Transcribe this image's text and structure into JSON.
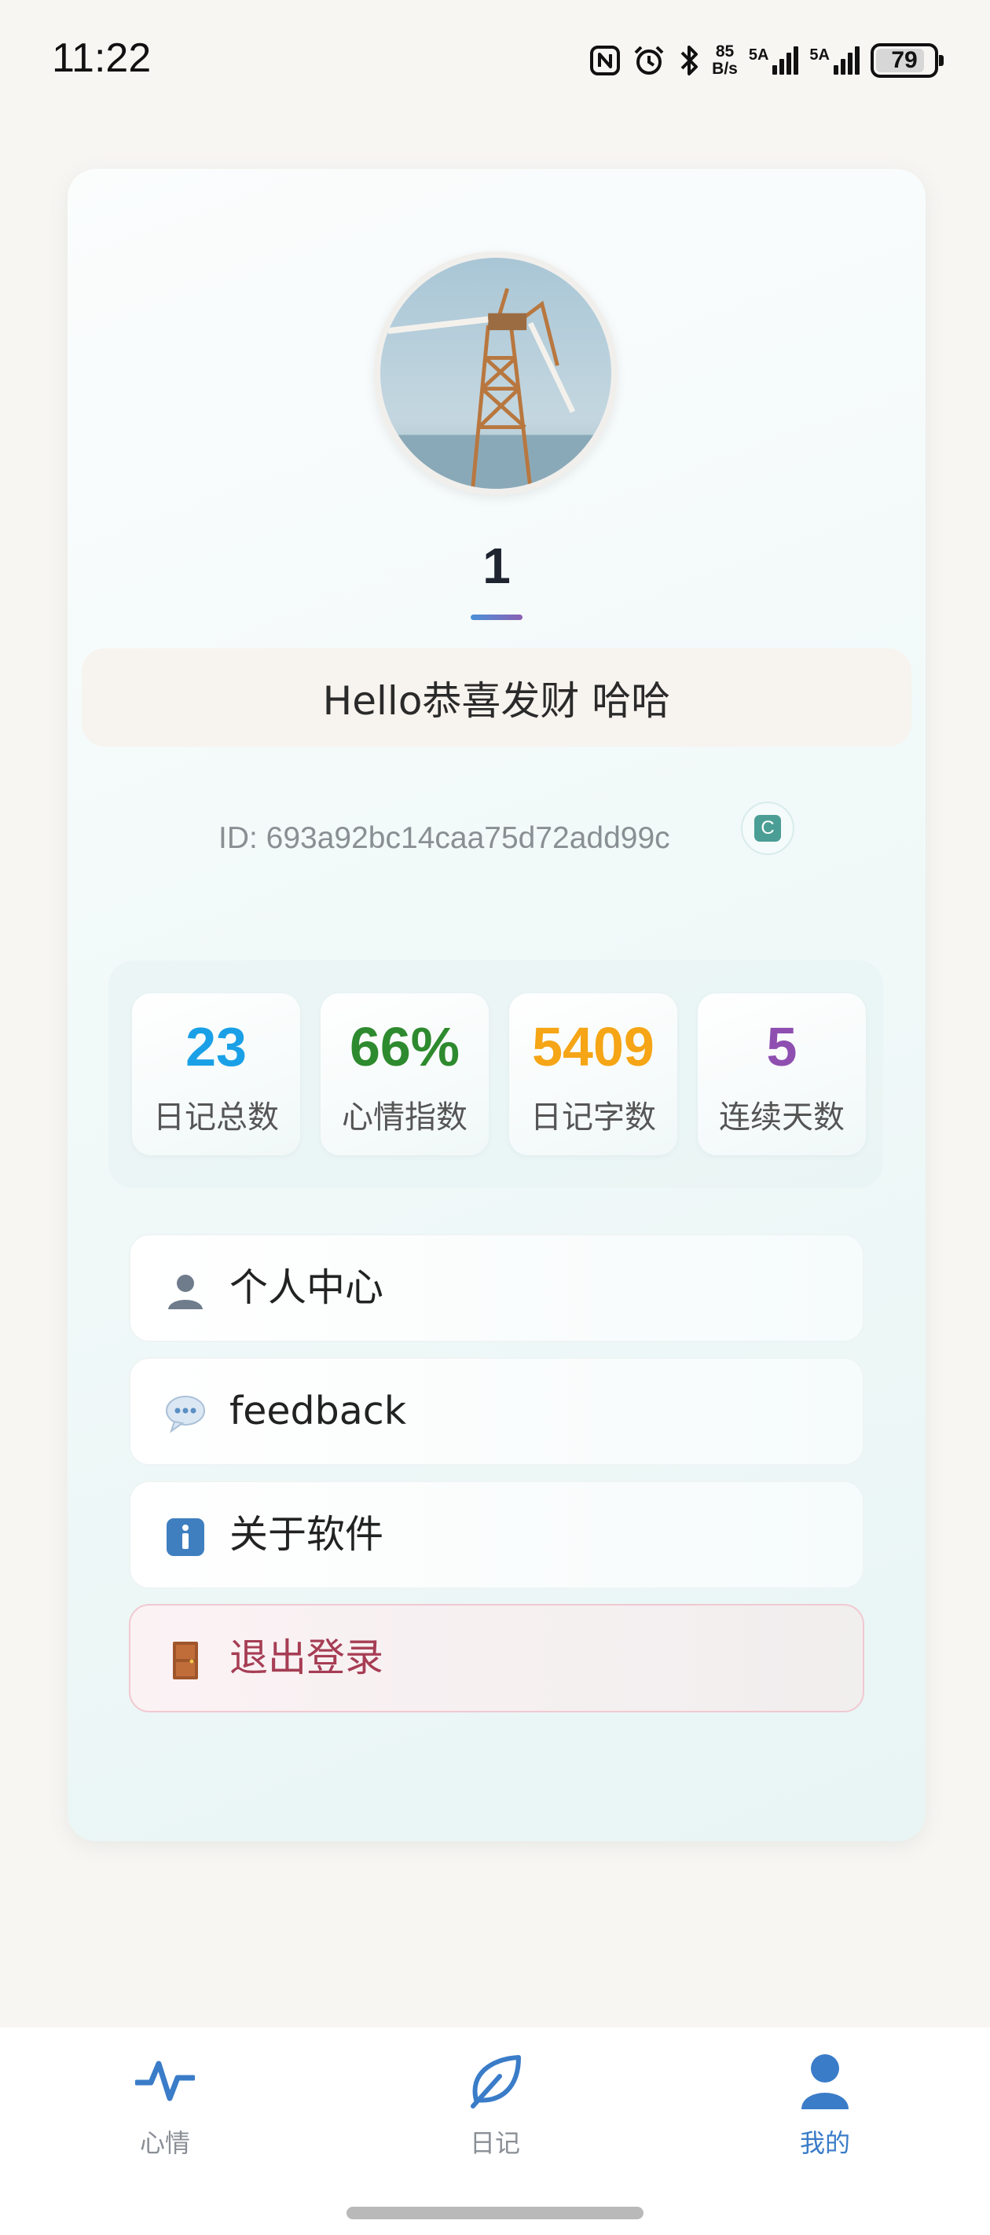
{
  "status_bar": {
    "time": "11:22",
    "net_speed_value": "85",
    "net_speed_unit": "B/s",
    "sim1_label": "5A",
    "sim2_label": "5A",
    "battery_level": "79",
    "icons": [
      "nfc-icon",
      "alarm-icon",
      "bluetooth-icon",
      "signal-icon",
      "battery-icon"
    ]
  },
  "profile": {
    "username": "1",
    "greeting": "Hello恭喜发财 哈哈",
    "user_id": "ID: 693a92bc14caa75d72add99c",
    "copy_label": "C"
  },
  "stats": [
    {
      "value": "23",
      "label": "日记总数",
      "color": "#1aa0e6"
    },
    {
      "value": "66%",
      "label": "心情指数",
      "color": "#2e8a2e"
    },
    {
      "value": "5409",
      "label": "日记字数",
      "color": "#f5a515"
    },
    {
      "value": "5",
      "label": "连续天数",
      "color": "#8e4fb0"
    }
  ],
  "menu": [
    {
      "label": "个人中心",
      "icon": "person-icon"
    },
    {
      "label": "feedback",
      "icon": "speech-bubble-icon"
    },
    {
      "label": "关于软件",
      "icon": "info-icon"
    },
    {
      "label": "退出登录",
      "icon": "door-icon"
    }
  ],
  "bottom_nav": {
    "items": [
      {
        "label": "心情",
        "icon": "heartbeat-icon",
        "active": false
      },
      {
        "label": "日记",
        "icon": "leaf-icon",
        "active": false
      },
      {
        "label": "我的",
        "icon": "user-icon",
        "active": true
      }
    ],
    "active_color": "#3a7cc8",
    "inactive_color": "#8a8f96"
  }
}
